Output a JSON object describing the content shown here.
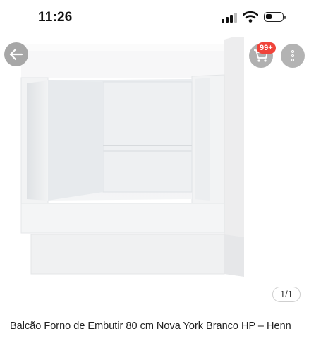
{
  "status_bar": {
    "time": "11:26",
    "icons": [
      "signal-icon",
      "wifi-icon",
      "battery-icon"
    ]
  },
  "top_bar": {
    "back_icon": "arrow-left-icon",
    "cart_icon": "cart-icon",
    "cart_badge": "99+",
    "more_icon": "more-vertical-icon"
  },
  "gallery": {
    "current_page": "1/1"
  },
  "product": {
    "title": "Balcão Forno de Embutir 80 cm Nova York Branco HP – Henn"
  },
  "colors": {
    "badge": "#f0443a",
    "overlay_button": "#a7a7a7"
  }
}
